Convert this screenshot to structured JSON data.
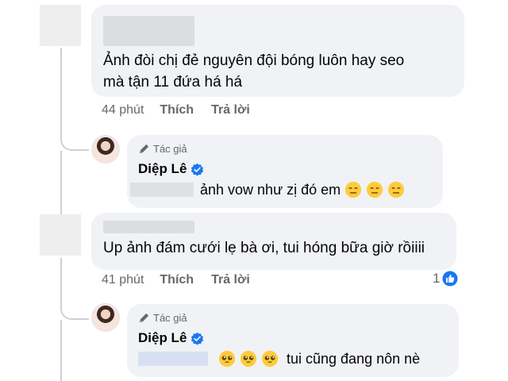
{
  "comments": [
    {
      "text_lines": [
        "Ảnh đòi chị đẻ nguyên đội bóng luôn hay seo",
        "mà tận 11 đứa há há"
      ],
      "time": "44 phút",
      "like_label": "Thích",
      "reply_label": "Trả lời",
      "reply": {
        "author_badge": "Tác giả",
        "author_name": "Diệp Lê",
        "text": "ảnh vow như zị đó em",
        "emojis": [
          "expressionless-face",
          "expressionless-face",
          "expressionless-face"
        ]
      }
    },
    {
      "text_lines": [
        "Up ảnh đám cưới lẹ bà ơi, tui hóng bữa giờ rồiiii"
      ],
      "time": "41 phút",
      "like_label": "Thích",
      "reply_label": "Trả lời",
      "reaction_count": "1",
      "reaction_icon": "like-icon",
      "reply": {
        "author_badge": "Tác giả",
        "author_name": "Diệp Lê",
        "text": "tui cũng đang nôn nè",
        "emojis": [
          "pleading-face",
          "pleading-face",
          "pleading-face"
        ]
      }
    }
  ],
  "colors": {
    "bubble": "#f0f2f5",
    "meta_text": "#65676b",
    "verified": "#1877f2",
    "like_blue": "#1877f2"
  }
}
